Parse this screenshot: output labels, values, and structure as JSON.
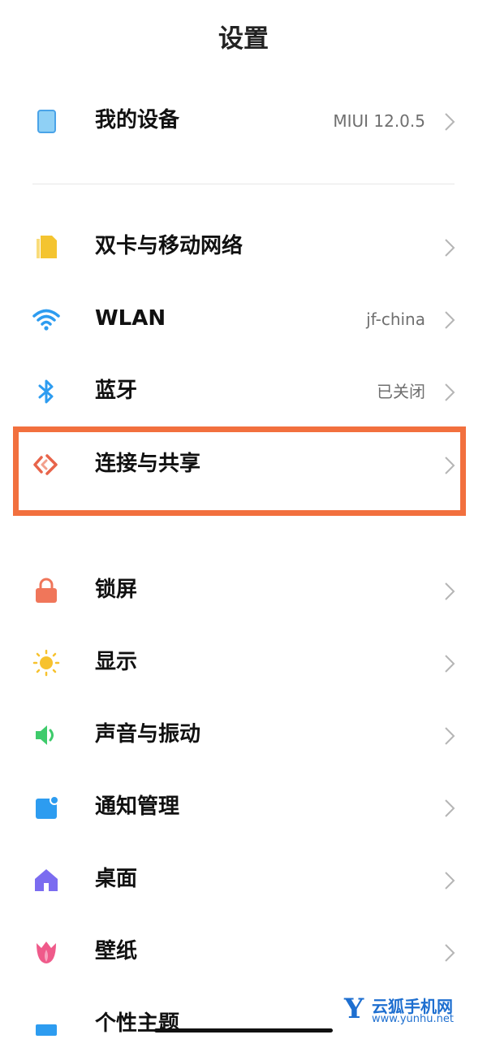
{
  "header": {
    "title": "设置"
  },
  "rows": [
    {
      "label": "我的设备",
      "value": "MIUI 12.0.5",
      "icon": "tablet-icon",
      "icon_color": "#4aa3e8"
    },
    {
      "label": "双卡与移动网络",
      "value": "",
      "icon": "sim-card-icon",
      "icon_color": "#f4c430"
    },
    {
      "label": "WLAN",
      "value": "jf-china",
      "icon": "wifi-icon",
      "icon_color": "#2d9cf0"
    },
    {
      "label": "蓝牙",
      "value": "已关闭",
      "icon": "bluetooth-icon",
      "icon_color": "#2d9cf0"
    },
    {
      "label": "连接与共享",
      "value": "",
      "icon": "connection-share-icon",
      "icon_color": "#e8644a"
    },
    {
      "label": "锁屏",
      "value": "",
      "icon": "lock-icon",
      "icon_color": "#f0765a"
    },
    {
      "label": "显示",
      "value": "",
      "icon": "sun-icon",
      "icon_color": "#f7c22e"
    },
    {
      "label": "声音与振动",
      "value": "",
      "icon": "speaker-icon",
      "icon_color": "#3ecb6b"
    },
    {
      "label": "通知管理",
      "value": "",
      "icon": "notification-icon",
      "icon_color": "#2d9cf0"
    },
    {
      "label": "桌面",
      "value": "",
      "icon": "home-icon",
      "icon_color": "#7b6cf0"
    },
    {
      "label": "壁纸",
      "value": "",
      "icon": "tulip-icon",
      "icon_color": "#ef5a8a"
    },
    {
      "label": "个性主题",
      "value": "",
      "icon": "theme-icon",
      "icon_color": "#2d9cf0"
    }
  ],
  "highlight_color": "#f2703e",
  "watermark": {
    "logo": "Y",
    "name": "云狐手机网",
    "url": "www.yunhu.net"
  }
}
